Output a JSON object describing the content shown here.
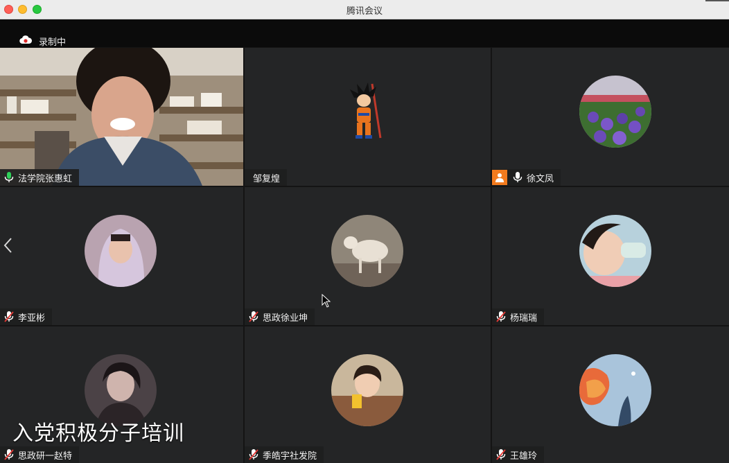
{
  "window": {
    "title": "腾讯会议"
  },
  "recording": {
    "label": "录制中"
  },
  "overlay": {
    "caption": "入党积极分子培训"
  },
  "colors": {
    "active_border": "#2fd15a",
    "host_badge": "#f27b1e",
    "recording_icon": "#ffffff"
  },
  "participants": [
    {
      "name": "法学院张惠虹",
      "mic": "on",
      "active": true,
      "type": "video"
    },
    {
      "name": "邹复煌",
      "mic": "none",
      "type": "cartoon-avatar"
    },
    {
      "name": "徐文凤",
      "mic": "on",
      "host": true,
      "type": "photo-avatar"
    },
    {
      "name": "李亚彬",
      "mic": "muted",
      "type": "photo-avatar"
    },
    {
      "name": "思政徐业坤",
      "mic": "muted",
      "type": "photo-avatar"
    },
    {
      "name": "杨瑞瑞",
      "mic": "muted",
      "type": "photo-avatar"
    },
    {
      "name": "思政研一赵特",
      "mic": "muted",
      "type": "photo-avatar"
    },
    {
      "name": "季皓宇社发院",
      "mic": "muted",
      "type": "photo-avatar"
    },
    {
      "name": "王雄玲",
      "mic": "muted",
      "type": "photo-avatar"
    }
  ],
  "icons": {
    "recording": "cloud-record-icon",
    "mic_on": "mic-icon",
    "mic_muted": "mic-muted-icon",
    "host": "host-icon",
    "prev_page": "chevron-left-icon"
  }
}
